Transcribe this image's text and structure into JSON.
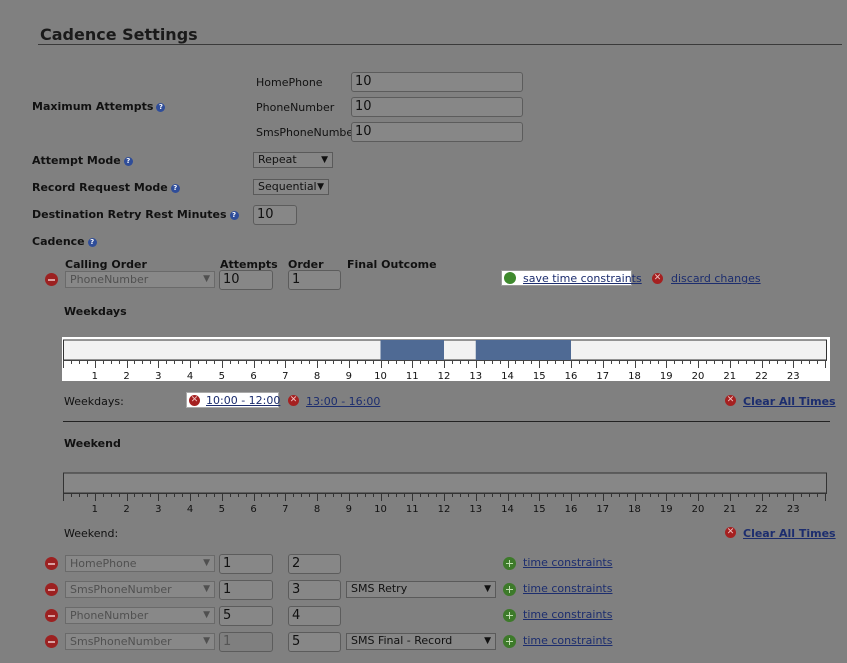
{
  "page": {
    "title": "Cadence Settings"
  },
  "max_attempts": {
    "label": "Maximum Attempts",
    "rows": [
      {
        "label": "HomePhone",
        "value": "10"
      },
      {
        "label": "PhoneNumber",
        "value": "10"
      },
      {
        "label": "SmsPhoneNumber",
        "value": "10"
      }
    ]
  },
  "attempt_mode": {
    "label": "Attempt Mode",
    "value": "Repeat"
  },
  "record_request_mode": {
    "label": "Record Request Mode",
    "value": "Sequential"
  },
  "destination_retry": {
    "label": "Destination Retry Rest Minutes",
    "value": "10"
  },
  "cadence": {
    "label": "Cadence",
    "headers": {
      "calling_order": "Calling Order",
      "attempts": "Attempts",
      "order": "Order",
      "final_outcome": "Final Outcome"
    },
    "active_row": {
      "phone": "PhoneNumber",
      "attempts": "10",
      "order": "1"
    },
    "save_label": "save time constraints",
    "discard_label": "discard changes",
    "rows": [
      {
        "phone": "HomePhone",
        "attempts": "1",
        "order": "2",
        "final_outcome": "",
        "link": "time constraints"
      },
      {
        "phone": "SmsPhoneNumber",
        "attempts": "1",
        "order": "3",
        "final_outcome": "SMS Retry",
        "link": "time constraints"
      },
      {
        "phone": "PhoneNumber",
        "attempts": "5",
        "order": "4",
        "final_outcome": "",
        "link": "time constraints"
      },
      {
        "phone": "SmsPhoneNumber",
        "attempts": "1",
        "order": "5",
        "final_outcome": "SMS Final - Record",
        "link": "time constraints"
      }
    ]
  },
  "weekdays": {
    "heading": "Weekdays",
    "summary_label": "Weekdays:",
    "hour_labels": [
      "1",
      "2",
      "3",
      "4",
      "5",
      "6",
      "7",
      "8",
      "9",
      "10",
      "11",
      "12",
      "13",
      "14",
      "15",
      "16",
      "17",
      "18",
      "19",
      "20",
      "21",
      "22",
      "23"
    ],
    "ranges": [
      {
        "label": "10:00 - 12:00",
        "start": 10,
        "end": 12
      },
      {
        "label": "13:00 - 16:00",
        "start": 13,
        "end": 16
      }
    ],
    "clear_label": "Clear All Times"
  },
  "weekend": {
    "heading": "Weekend",
    "summary_label": "Weekend:",
    "hour_labels": [
      "1",
      "2",
      "3",
      "4",
      "5",
      "6",
      "7",
      "8",
      "9",
      "10",
      "11",
      "12",
      "13",
      "14",
      "15",
      "16",
      "17",
      "18",
      "19",
      "20",
      "21",
      "22",
      "23"
    ],
    "ranges": [],
    "clear_label": "Clear All Times"
  },
  "colors": {
    "overlay": "#808080",
    "range_fill": "#4f6a94",
    "timeline_bg": "#f2f2f2"
  }
}
